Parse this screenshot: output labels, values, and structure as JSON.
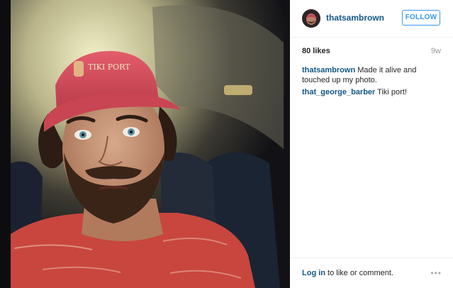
{
  "post": {
    "username": "thatsambrown",
    "follow_label": "FOLLOW",
    "likes": "80 likes",
    "age": "9w",
    "caption": {
      "user": "thatsambrown",
      "text": "Made it alive and touched up my photo."
    },
    "comments": [
      {
        "user": "that_george_barber",
        "text": "Tiki port!"
      }
    ],
    "footer": {
      "login_link": "Log in",
      "login_rest": " to like or comment.",
      "more_icon": "•••"
    }
  },
  "photo": {
    "hat_text": "TIKI PORT",
    "colors": {
      "shirt": "#c8463e",
      "hat": "#d44d5a",
      "skin": "#c89a7c",
      "beard": "#3a2418"
    }
  },
  "theme": {
    "link": "#125688",
    "accent": "#3897f0",
    "muted": "#999999"
  }
}
